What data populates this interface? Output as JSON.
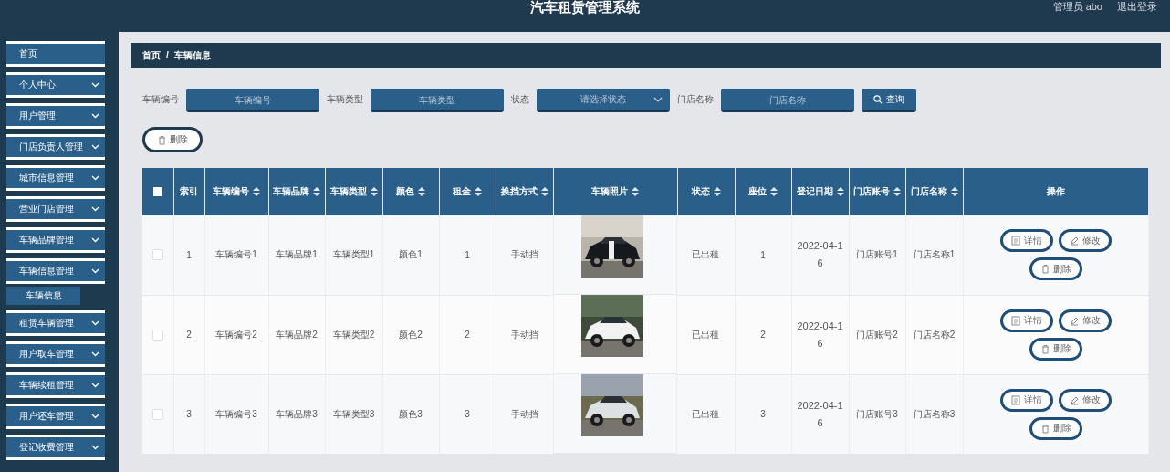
{
  "header": {
    "title": "汽车租赁管理系统",
    "user": "管理员 abo",
    "logout": "退出登录"
  },
  "sidebar": {
    "items": [
      {
        "label": "首页",
        "kind": "link"
      },
      {
        "label": "个人中心",
        "kind": "menu"
      },
      {
        "label": "用户管理",
        "kind": "menu"
      },
      {
        "label": "门店负责人管理",
        "kind": "menu"
      },
      {
        "label": "城市信息管理",
        "kind": "menu"
      },
      {
        "label": "营业门店管理",
        "kind": "menu"
      },
      {
        "label": "车辆品牌管理",
        "kind": "menu"
      },
      {
        "label": "车辆信息管理",
        "kind": "menu",
        "children": [
          {
            "label": "车辆信息",
            "selected": true
          }
        ]
      },
      {
        "label": "租赁车辆管理",
        "kind": "menu"
      },
      {
        "label": "用户取车管理",
        "kind": "menu"
      },
      {
        "label": "车辆续租管理",
        "kind": "menu"
      },
      {
        "label": "用户还车管理",
        "kind": "menu"
      },
      {
        "label": "登记收费管理",
        "kind": "menu"
      }
    ]
  },
  "breadcrumb": {
    "items": [
      "首页",
      "车辆信息"
    ],
    "separator": "/"
  },
  "filters": [
    {
      "label": "车辆编号",
      "placeholder": "车辆编号",
      "kind": "input"
    },
    {
      "label": "车辆类型",
      "placeholder": "车辆类型",
      "kind": "input"
    },
    {
      "label": "状态",
      "placeholder": "请选择状态",
      "kind": "select"
    },
    {
      "label": "门店名称",
      "placeholder": "门店名称",
      "kind": "input"
    }
  ],
  "search_button": "查询",
  "delete_button": "删除",
  "table": {
    "header_checked": false,
    "columns": [
      {
        "label": "索引",
        "sortable": false
      },
      {
        "label": "车辆编号",
        "sortable": true
      },
      {
        "label": "车辆品牌",
        "sortable": true
      },
      {
        "label": "车辆类型",
        "sortable": true
      },
      {
        "label": "颜色",
        "sortable": true
      },
      {
        "label": "租金",
        "sortable": true
      },
      {
        "label": "换挡方式",
        "sortable": true
      },
      {
        "label": "车辆照片",
        "sortable": true
      },
      {
        "label": "状态",
        "sortable": true
      },
      {
        "label": "座位",
        "sortable": true
      },
      {
        "label": "登记日期",
        "sortable": true
      },
      {
        "label": "门店账号",
        "sortable": true
      },
      {
        "label": "门店名称",
        "sortable": true
      },
      {
        "label": "操作",
        "sortable": false
      }
    ],
    "rows": [
      {
        "checked": false,
        "cells": [
          "1",
          "车辆编号1",
          "车辆品牌1",
          "车辆类型1",
          "颜色1",
          "1",
          "手动挡",
          {
            "kind": "picture"
          },
          "已出租",
          "1",
          "2022-04-16",
          "门店账号1",
          "门店名称1"
        ],
        "actions": [
          {
            "label": "详情",
            "kind": "detail"
          },
          {
            "label": "修改",
            "kind": "edit"
          },
          {
            "label": "删除",
            "kind": "delete"
          }
        ]
      },
      {
        "checked": false,
        "cells": [
          "2",
          "车辆编号2",
          "车辆品牌2",
          "车辆类型2",
          "颜色2",
          "2",
          "手动挡",
          {
            "kind": "picture"
          },
          "已出租",
          "2",
          "2022-04-16",
          "门店账号2",
          "门店名称2"
        ],
        "actions": [
          {
            "label": "详情",
            "kind": "detail"
          },
          {
            "label": "修改",
            "kind": "edit"
          },
          {
            "label": "删除",
            "kind": "delete"
          }
        ]
      },
      {
        "checked": false,
        "cells": [
          "3",
          "车辆编号3",
          "车辆品牌3",
          "车辆类型3",
          "颜色3",
          "3",
          "手动挡",
          {
            "kind": "picture"
          },
          "已出租",
          "3",
          "2022-04-16",
          "门店账号3",
          "门店名称3"
        ],
        "actions": [
          {
            "label": "详情",
            "kind": "detail"
          },
          {
            "label": "修改",
            "kind": "edit"
          },
          {
            "label": "删除",
            "kind": "delete"
          }
        ]
      }
    ]
  }
}
